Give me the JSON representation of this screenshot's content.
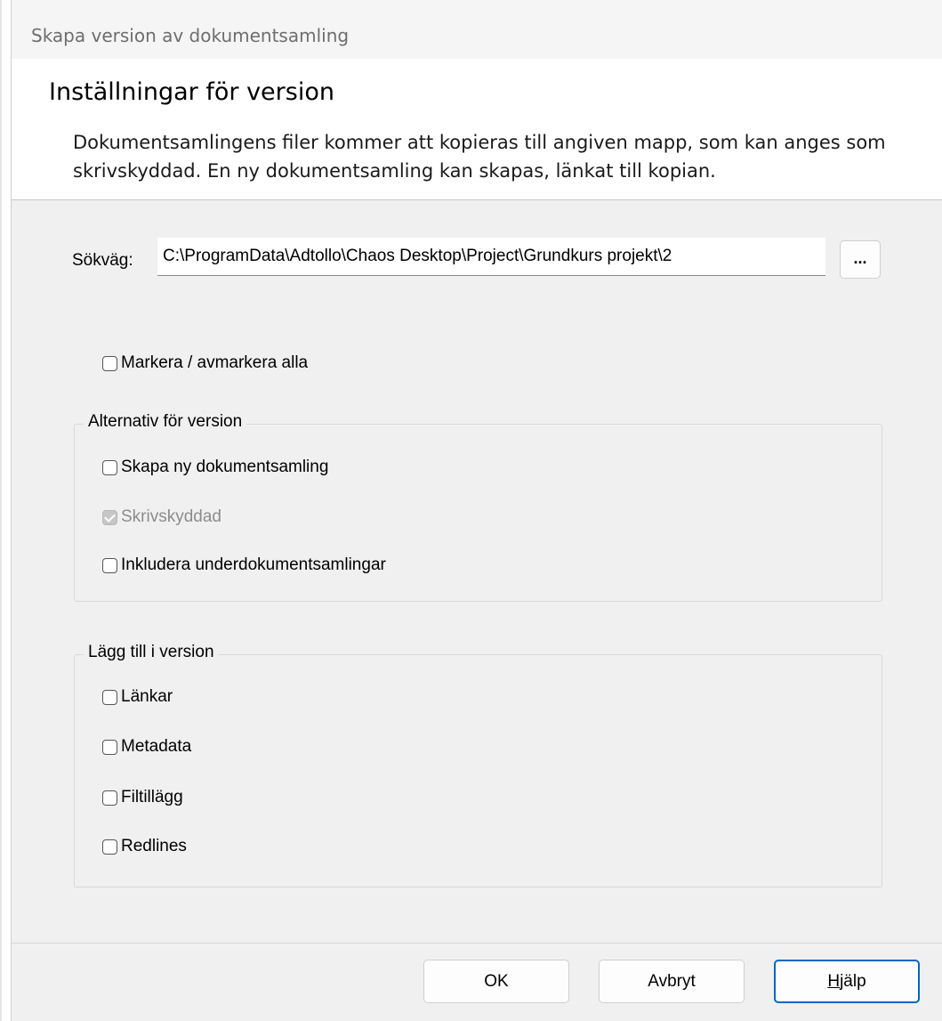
{
  "window": {
    "title": "Skapa version av dokumentsamling"
  },
  "header": {
    "title": "Inställningar för version",
    "description": "Dokumentsamlingens filer kommer att kopieras till angiven mapp, som kan anges som skrivskyddad. En ny dokumentsamling kan skapas, länkat till kopian."
  },
  "path": {
    "label": "Sökväg:",
    "value": "C:\\ProgramData\\Adtollo\\Chaos Desktop\\Project\\Grundkurs projekt\\2",
    "browse_label": "..."
  },
  "select_all": {
    "label": "Markera / avmarkera alla",
    "checked": false
  },
  "version_options": {
    "legend": "Alternativ för version",
    "items": [
      {
        "label": "Skapa ny dokumentsamling",
        "checked": false,
        "enabled": true
      },
      {
        "label": "Skrivskyddad",
        "checked": true,
        "enabled": false
      },
      {
        "label": "Inkludera underdokumentsamlingar",
        "checked": false,
        "enabled": true
      }
    ]
  },
  "add_to_version": {
    "legend": "Lägg till i version",
    "items": [
      {
        "label": "Länkar",
        "checked": false
      },
      {
        "label": "Metadata",
        "checked": false
      },
      {
        "label": "Filtillägg",
        "checked": false
      },
      {
        "label": "Redlines",
        "checked": false
      }
    ]
  },
  "buttons": {
    "ok": "OK",
    "cancel": "Avbryt",
    "help_mnemonic": "H",
    "help_rest": "jälp"
  }
}
